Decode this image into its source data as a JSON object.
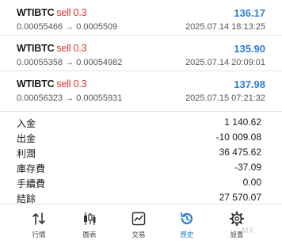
{
  "trades": [
    {
      "symbol": "WTIBTC",
      "side": "sell 0.3",
      "prices": "0.00055466 → 0.0005509",
      "profit": "136.17",
      "time": "2025.07.14 18:13:25"
    },
    {
      "symbol": "WTIBTC",
      "side": "sell 0.3",
      "prices": "0.00055358 → 0.00054982",
      "profit": "135.90",
      "time": "2025.07.14 20:09:01"
    },
    {
      "symbol": "WTIBTC",
      "side": "sell 0.3",
      "prices": "0.00056323 → 0.00055931",
      "profit": "137.98",
      "time": "2025.07.15 07:21:32"
    }
  ],
  "summary": [
    {
      "label": "入金",
      "value": "1 140.62"
    },
    {
      "label": "出金",
      "value": "-10 009.08"
    },
    {
      "label": "利潤",
      "value": "36 475.62"
    },
    {
      "label": "庫存費",
      "value": "-37.09"
    },
    {
      "label": "手續費",
      "value": "0.00"
    },
    {
      "label": "結餘",
      "value": "27 570.07"
    }
  ],
  "tabs": [
    {
      "label": "行情",
      "icon": "quotes-arrows-icon"
    },
    {
      "label": "圖表",
      "icon": "candlestick-chart-icon"
    },
    {
      "label": "交易",
      "icon": "trade-chart-icon"
    },
    {
      "label": "歷史",
      "icon": "history-clock-icon",
      "active": true
    },
    {
      "label": "設置",
      "icon": "settings-gear-icon"
    }
  ],
  "watermark": "MX",
  "colors": {
    "sell": "#d6342b",
    "profit": "#2a7fd4",
    "active_tab": "#2a7fd4"
  }
}
